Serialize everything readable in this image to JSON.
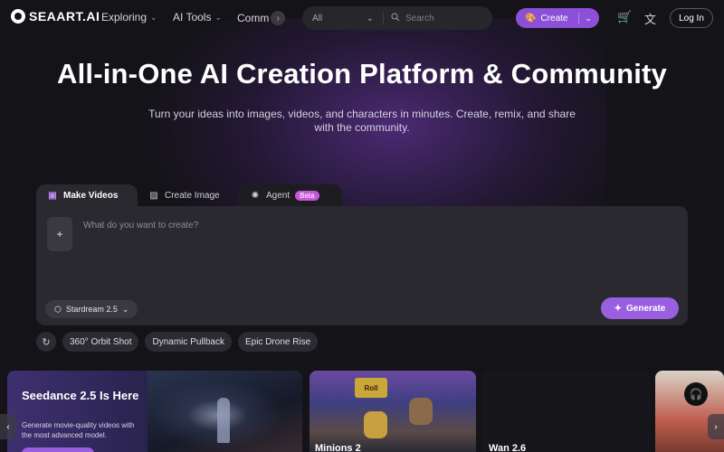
{
  "header": {
    "logo_text": "SEAART.AI",
    "nav": [
      {
        "label": "Exploring"
      },
      {
        "label": "AI Tools"
      },
      {
        "label": "Comm"
      }
    ],
    "search": {
      "category": "All",
      "placeholder": "Search"
    },
    "create_label": "Create",
    "login_label": "Log In"
  },
  "hero": {
    "title": "All-in-One AI Creation Platform & Community",
    "subtitle": "Turn your ideas into images, videos, and characters in minutes. Create, remix, and share with the community."
  },
  "tabs": [
    {
      "label": "Make Videos",
      "icon": "video-icon"
    },
    {
      "label": "Create Image",
      "icon": "image-icon"
    },
    {
      "label": "Agent",
      "icon": "agent-icon",
      "badge": "Beta"
    }
  ],
  "prompt": {
    "upload_symbol": "+",
    "placeholder": "What do you want to create?",
    "model": "Stardream 2.5",
    "generate_label": "Generate"
  },
  "chips": [
    "360° Orbit Shot",
    "Dynamic Pullback",
    "Epic Drone Rise"
  ],
  "cards": [
    {
      "title": "Seedance 2.5 Is Here",
      "desc": "Generate movie-quality videos with the most advanced model."
    },
    {
      "sign": "Roll",
      "label": "Minions 2"
    },
    {
      "label": "Wan 2.6"
    }
  ],
  "colors": {
    "accent": "#9a5fe0",
    "background": "#141317",
    "panel": "#2a292f",
    "beta": "#c557d8"
  }
}
